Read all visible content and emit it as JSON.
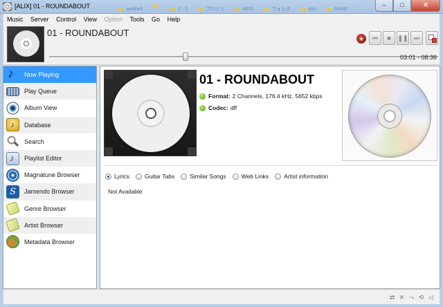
{
  "window": {
    "title": "[ALIX] 01 - ROUNDABOUT",
    "taskbar_tabs": [
      "awahelt",
      "",
      "1 - 2",
      "プロジェ",
      "MRG",
      "フォルダ",
      "doc",
      "ARHR",
      ""
    ],
    "buttons": {
      "minimize": "–",
      "maximize": "□",
      "close": "✕"
    }
  },
  "menu": [
    {
      "label": "Music",
      "enabled": true
    },
    {
      "label": "Server",
      "enabled": true
    },
    {
      "label": "Control",
      "enabled": true
    },
    {
      "label": "View",
      "enabled": true
    },
    {
      "label": "Option",
      "enabled": false
    },
    {
      "label": "Tools",
      "enabled": true
    },
    {
      "label": "Go",
      "enabled": true
    },
    {
      "label": "Help",
      "enabled": true
    }
  ],
  "player": {
    "song_title": "01 - ROUNDABOUT",
    "time": "03:01 - 08:36",
    "progress_fraction": 0.35,
    "favorite_icon": "star-icon",
    "controls": [
      {
        "name": "previous",
        "glyph": "⏮"
      },
      {
        "name": "stop",
        "glyph": "■"
      },
      {
        "name": "pause",
        "glyph": "❚❚"
      },
      {
        "name": "next",
        "glyph": "⏭"
      }
    ]
  },
  "sidebar": {
    "selected": 0,
    "items": [
      {
        "label": "Now Playing",
        "icon": "music-note-icon"
      },
      {
        "label": "Play Queue",
        "icon": "play-queue-icon"
      },
      {
        "label": "Album View",
        "icon": "eye-icon"
      },
      {
        "label": "Database",
        "icon": "database-icon"
      },
      {
        "label": "Search",
        "icon": "search-icon"
      },
      {
        "label": "Playlist Editor",
        "icon": "playlist-icon"
      },
      {
        "label": "Magnatune Browser",
        "icon": "magnatune-icon"
      },
      {
        "label": "Jamendo Browser",
        "icon": "jamendo-icon"
      },
      {
        "label": "Genre Browser",
        "icon": "tag-icon"
      },
      {
        "label": "Artist Browser",
        "icon": "tag-icon"
      },
      {
        "label": "Metadata Browser",
        "icon": "guitar-icon"
      }
    ]
  },
  "now_playing": {
    "track_name": "01 - ROUNDABOUT",
    "format_label": "Format:",
    "format_value": "2 Channels, 176.4 kHz, 5652 kbps",
    "codec_label": "Codec:",
    "codec_value": "dff",
    "tabs": [
      {
        "label": "Lyrics",
        "selected": true
      },
      {
        "label": "Guitar Tabs",
        "selected": false
      },
      {
        "label": "Similar Songs",
        "selected": false
      },
      {
        "label": "Web Links",
        "selected": false
      },
      {
        "label": "Artist information",
        "selected": false
      }
    ],
    "lyrics_text": "Not Available"
  },
  "status_icons": [
    "repeat-icon",
    "shuffle-icon",
    "consume-icon",
    "single-icon",
    "volume-icon"
  ],
  "colors": {
    "selection": "#3399ff",
    "accent_green": "#4a9a1c",
    "favorite_red": "#9a1b1b"
  }
}
